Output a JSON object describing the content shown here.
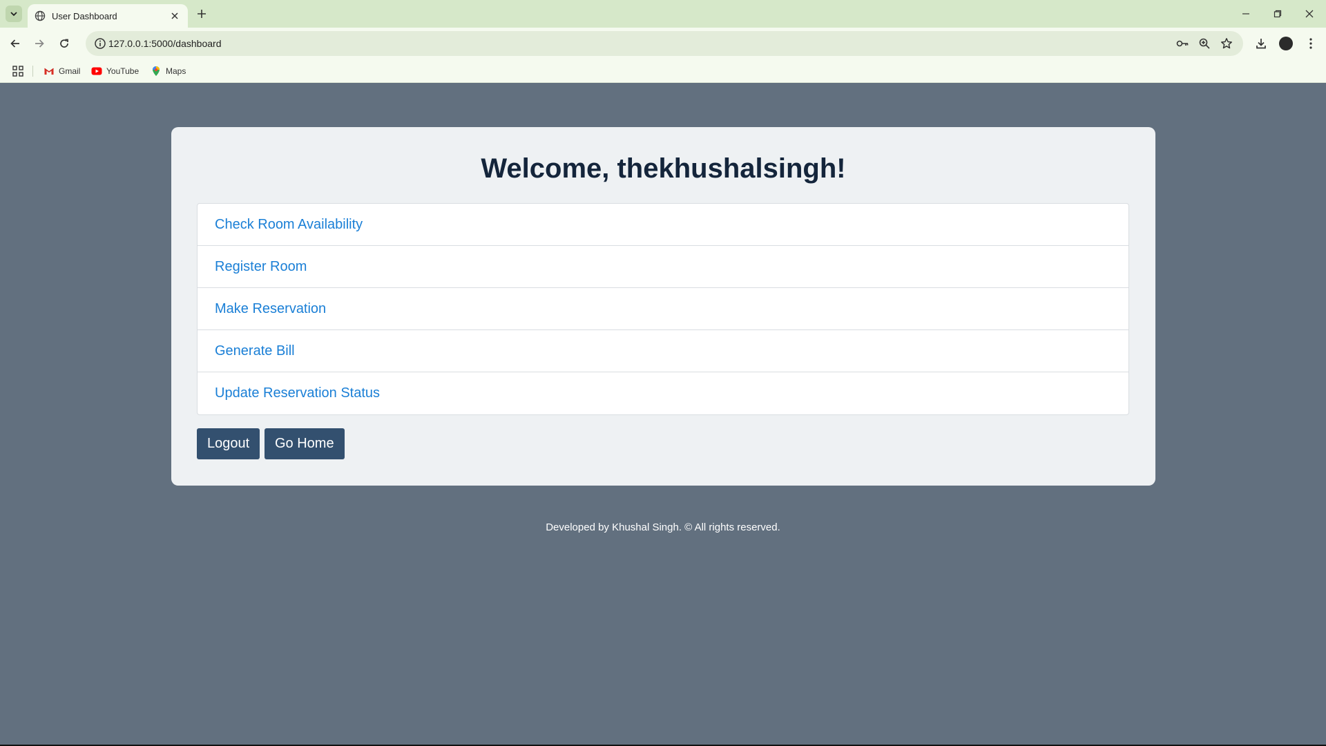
{
  "browser": {
    "tab_title": "User Dashboard",
    "url": "127.0.0.1:5000/dashboard",
    "bookmarks": [
      {
        "label": "Gmail",
        "icon": "gmail-icon"
      },
      {
        "label": "YouTube",
        "icon": "youtube-icon"
      },
      {
        "label": "Maps",
        "icon": "maps-icon"
      }
    ],
    "icons": [
      "tab-search-icon",
      "globe-icon",
      "close-icon",
      "plus-icon",
      "minimize-icon",
      "restore-icon",
      "window-close-icon",
      "back-icon",
      "forward-icon",
      "reload-icon",
      "info-icon",
      "key-icon",
      "zoom-icon",
      "star-icon",
      "download-icon",
      "profile-avatar",
      "more-icon",
      "apps-icon"
    ]
  },
  "page": {
    "heading": "Welcome, thekhushalsingh!",
    "menu": [
      "Check Room Availability",
      "Register Room",
      "Make Reservation",
      "Generate Bill",
      "Update Reservation Status"
    ],
    "logout_label": "Logout",
    "home_label": "Go Home",
    "footer": "Developed by Khushal Singh. © All rights reserved."
  },
  "colors": {
    "page_background": "#62707f",
    "card_background": "#eef1f3",
    "link": "#1a7fd6",
    "button": "#33506f",
    "heading": "#14253b",
    "chrome": "#d6e8c9"
  }
}
